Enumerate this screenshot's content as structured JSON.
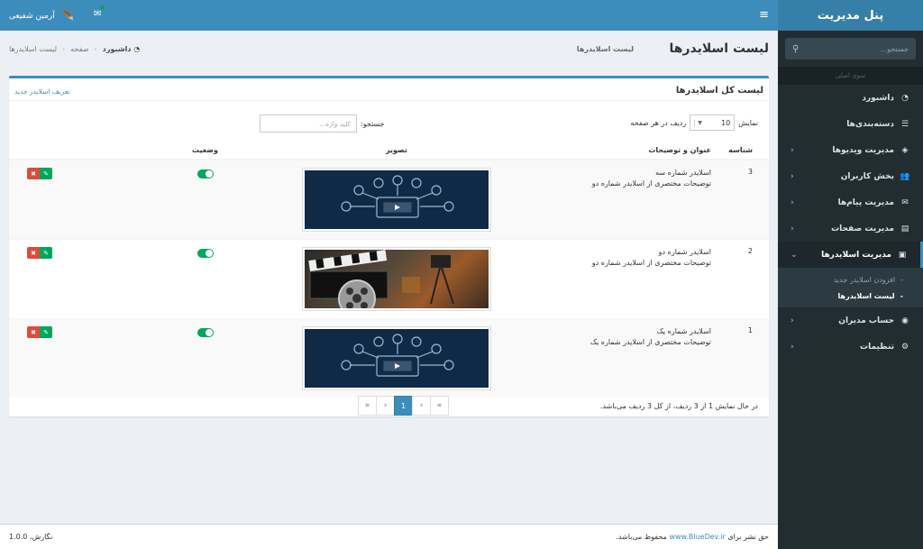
{
  "sidebar": {
    "brand": "پنل مدیریت",
    "search_placeholder": "جستجو...",
    "header": "منوی اصلی",
    "items": [
      {
        "label": "داشبورد",
        "icon": "dashboard-icon"
      },
      {
        "label": "دسته‌بندی‌ها",
        "icon": "list-icon"
      },
      {
        "label": "مدیریت ویدیوها",
        "icon": "film-icon"
      },
      {
        "label": "بخش کاربران",
        "icon": "users-icon"
      },
      {
        "label": "مدیریت پیام‌ها",
        "icon": "envelope-icon"
      },
      {
        "label": "مدیریت صفحات",
        "icon": "file-icon"
      },
      {
        "label": "مدیریت اسلایدرها",
        "icon": "image-icon"
      },
      {
        "label": "حساب مدیران",
        "icon": "user-circle-icon"
      },
      {
        "label": "تنظیمات",
        "icon": "gear-icon"
      }
    ],
    "submenu": [
      {
        "label": "افزودن اسلایدر جدید"
      },
      {
        "label": "لیست اسلایدرها"
      }
    ]
  },
  "navbar": {
    "user_name": "آرمین شفیعی"
  },
  "header": {
    "title": "لیست اسلایدرها",
    "subtitle": "لیست اسلایدرها",
    "breadcrumb": [
      "داشبورد",
      "صفحه",
      "لیست اسلایدرها"
    ]
  },
  "box": {
    "title": "لیست کل اسلایدرها",
    "new_link": "تعریف اسلایدر جدید",
    "length_prefix": "نمایش",
    "length_value": "10",
    "length_suffix": "ردیف در هر صفحه",
    "search_label": "جستجو:",
    "search_placeholder": "کلید واژه...",
    "columns": {
      "id": "شناسه",
      "title": "عنوان و توضیحات",
      "image": "تصویر",
      "status": "وضعیت"
    },
    "rows": [
      {
        "id": "3",
        "title": "اسلایدر شماره سه",
        "desc": "توضیحات مختصری از اسلایدر شماره دو",
        "status": true
      },
      {
        "id": "2",
        "title": "اسلایدر شماره دو",
        "desc": "توضیحات مختصری از اسلایدر شماره دو",
        "status": true
      },
      {
        "id": "1",
        "title": "اسلایدر شماره یک",
        "desc": "توضیحات مختصری از اسلایدر شماره یک",
        "status": true
      }
    ],
    "info": "در حال نمایش 1 از 3 ردیف، از کل 3 ردیف می‌باشد.",
    "pager": {
      "first": "«",
      "prev": "‹",
      "current": "1",
      "next": "›",
      "last": "»"
    }
  },
  "footer": {
    "copy_prefix": "حق نشر برای",
    "copy_link": "www.BlueDev.ir",
    "copy_suffix": "محفوظ می‌باشد.",
    "version": "نگارش، 1.0.0"
  },
  "colors": {
    "primary": "#3c8dbc",
    "sidebar_bg": "#222d32",
    "success": "#00a65a",
    "danger": "#dd4b39"
  }
}
